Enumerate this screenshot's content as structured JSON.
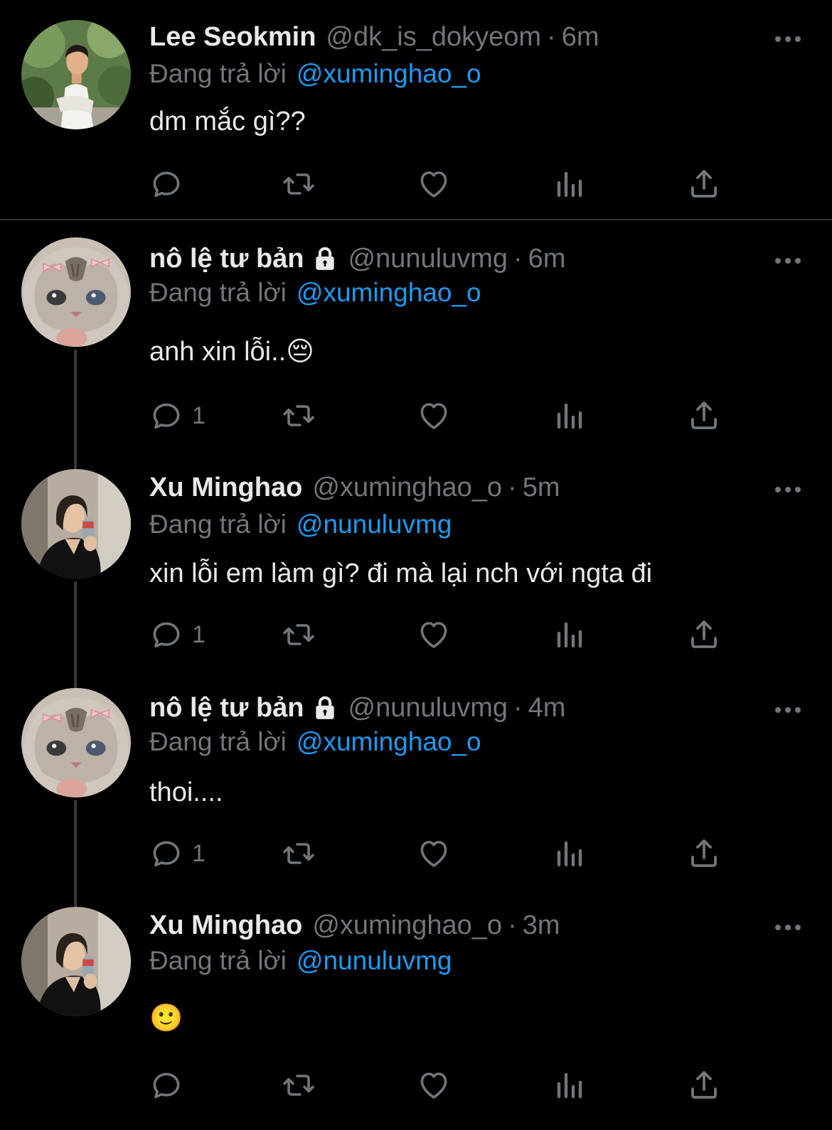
{
  "colors": {
    "background": "#000000",
    "text": "#e7e9ea",
    "muted": "#71767b",
    "accent": "#1d9bf0",
    "thread_line": "#333639"
  },
  "reply_prefix": "Đang trả lời",
  "icons": [
    "reply-icon",
    "retweet-icon",
    "like-icon",
    "views-icon",
    "share-icon",
    "more-icon",
    "lock-icon"
  ],
  "tweets": [
    {
      "name": "Lee Seokmin",
      "handle": "@dk_is_dokyeom",
      "separator": "·",
      "time": "6m",
      "reply_to": "@xuminghao_o",
      "text": "dm mắc gì??",
      "reply_count": ""
    },
    {
      "name": "nô lệ tư bản",
      "handle": "@nunuluvmg",
      "separator": "·",
      "time": "6m",
      "reply_to": "@xuminghao_o",
      "text": "anh xin lỗi..😔",
      "reply_count": "1"
    },
    {
      "name": "Xu Minghao",
      "handle": "@xuminghao_o",
      "separator": "·",
      "time": "5m",
      "reply_to": "@nunuluvmg",
      "text": "xin lỗi em làm gì? đi mà lại nch với ngta đi",
      "reply_count": "1"
    },
    {
      "name": "nô lệ tư bản",
      "handle": "@nunuluvmg",
      "separator": "·",
      "time": "4m",
      "reply_to": "@xuminghao_o",
      "text": "thoi....",
      "reply_count": "1"
    },
    {
      "name": "Xu Minghao",
      "handle": "@xuminghao_o",
      "separator": "·",
      "time": "3m",
      "reply_to": "@nunuluvmg",
      "text": "🙂",
      "reply_count": ""
    }
  ]
}
